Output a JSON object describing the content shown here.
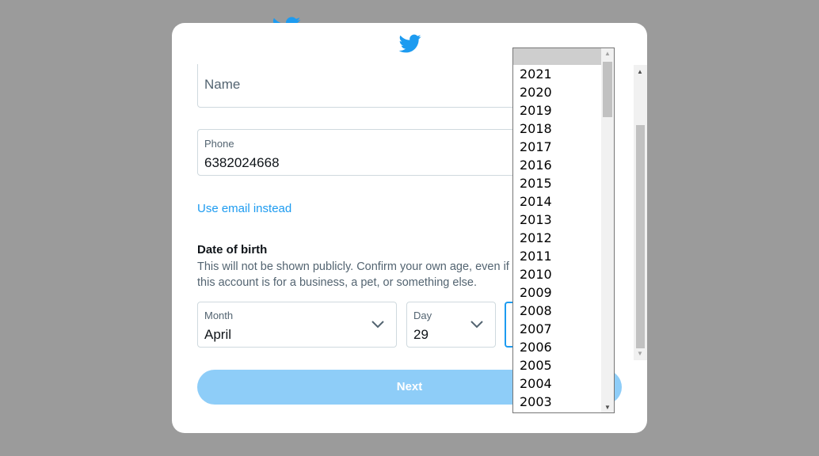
{
  "colors": {
    "overlay": "#9b9b9b",
    "accent": "#1d9bf0",
    "button_disabled": "#8ecdf8"
  },
  "icons": {
    "logo": "twitter-bird-icon",
    "select_arrow": "chevron-down-icon"
  },
  "form": {
    "name": {
      "placeholder": "Name"
    },
    "phone": {
      "label": "Phone",
      "value": "6382024668"
    },
    "email_link": "Use email instead",
    "dob": {
      "title": "Date of birth",
      "description": "This will not be shown publicly. Confirm your own age, even if this account is for a business, a pet, or something else."
    },
    "month": {
      "label": "Month",
      "value": "April"
    },
    "day": {
      "label": "Day",
      "value": "29"
    },
    "next_label": "Next"
  },
  "year_dropdown": {
    "selected": "",
    "options": [
      "2021",
      "2020",
      "2019",
      "2018",
      "2017",
      "2016",
      "2015",
      "2014",
      "2013",
      "2012",
      "2011",
      "2010",
      "2009",
      "2008",
      "2007",
      "2006",
      "2005",
      "2004",
      "2003"
    ]
  }
}
